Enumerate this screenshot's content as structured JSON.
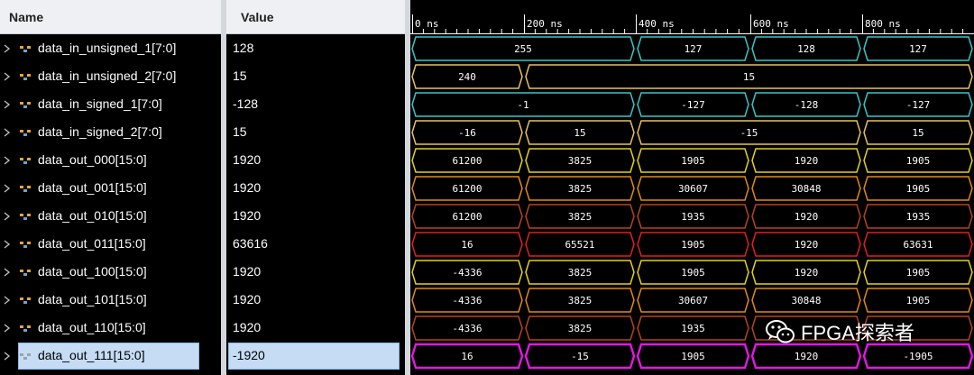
{
  "columns": {
    "name": "Name",
    "value": "Value"
  },
  "ruler": {
    "ticks": [
      "0 ns",
      "200 ns",
      "400 ns",
      "600 ns",
      "800 ns"
    ]
  },
  "selected_index": 11,
  "signals": [
    {
      "name": "data_in_unsigned_1[7:0]",
      "value": "128",
      "icon": "bus-icon",
      "color": "#36c7c9",
      "segments": [
        "255",
        "127",
        "128",
        "127"
      ],
      "boundaries": [
        0,
        250,
        377,
        501,
        625
      ]
    },
    {
      "name": "data_in_unsigned_2[7:0]",
      "value": "15",
      "icon": "bus-icon",
      "color": "#e6c25a",
      "segments": [
        "240",
        "15"
      ],
      "boundaries": [
        0,
        126,
        625
      ]
    },
    {
      "name": "data_in_signed_1[7:0]",
      "value": "-128",
      "icon": "bus-icon",
      "color": "#36c7c9",
      "segments": [
        "-1",
        "-127",
        "-128",
        "-127"
      ],
      "boundaries": [
        0,
        250,
        377,
        501,
        625
      ]
    },
    {
      "name": "data_in_signed_2[7:0]",
      "value": "15",
      "icon": "bus-icon",
      "color": "#e6c25a",
      "segments": [
        "-16",
        "15",
        "-15",
        "15"
      ],
      "boundaries": [
        0,
        126,
        250,
        501,
        625
      ]
    },
    {
      "name": "data_out_000[15:0]",
      "value": "1920",
      "icon": "bus-icon",
      "color": "#e3d21b",
      "segments": [
        "61200",
        "3825",
        "1905",
        "1920",
        "1905"
      ],
      "boundaries": [
        0,
        126,
        250,
        377,
        501,
        625
      ]
    },
    {
      "name": "data_out_001[15:0]",
      "value": "1920",
      "icon": "bus-icon",
      "color": "#e08a16",
      "segments": [
        "61200",
        "3825",
        "30607",
        "30848",
        "1905"
      ],
      "boundaries": [
        0,
        126,
        250,
        377,
        501,
        625
      ]
    },
    {
      "name": "data_out_010[15:0]",
      "value": "1920",
      "icon": "bus-icon",
      "color": "#b3451d",
      "segments": [
        "61200",
        "3825",
        "1935",
        "1920",
        "1935"
      ],
      "boundaries": [
        0,
        126,
        250,
        377,
        501,
        625
      ]
    },
    {
      "name": "data_out_011[15:0]",
      "value": "63616",
      "icon": "bus-icon",
      "color": "#e02020",
      "segments": [
        "16",
        "65521",
        "1905",
        "1920",
        "63631"
      ],
      "boundaries": [
        0,
        126,
        250,
        377,
        501,
        625
      ]
    },
    {
      "name": "data_out_100[15:0]",
      "value": "1920",
      "icon": "bus-icon",
      "color": "#e3d21b",
      "segments": [
        "-4336",
        "3825",
        "1905",
        "1920",
        "1905"
      ],
      "boundaries": [
        0,
        126,
        250,
        377,
        501,
        625
      ]
    },
    {
      "name": "data_out_101[15:0]",
      "value": "1920",
      "icon": "bus-icon",
      "color": "#e08a16",
      "segments": [
        "-4336",
        "3825",
        "30607",
        "30848",
        "1905"
      ],
      "boundaries": [
        0,
        126,
        250,
        377,
        501,
        625
      ]
    },
    {
      "name": "data_out_110[15:0]",
      "value": "1920",
      "icon": "bus-icon",
      "color": "#b3451d",
      "segments": [
        "-4336",
        "3825",
        "1935",
        "",
        ""
      ],
      "boundaries": [
        0,
        126,
        250,
        377,
        501,
        625
      ]
    },
    {
      "name": "data_out_111[15:0]",
      "value": "-1920",
      "icon": "bus-icon",
      "color": "#e516e5",
      "segments": [
        "16",
        "-15",
        "1905",
        "1920",
        "-1905"
      ],
      "boundaries": [
        0,
        126,
        250,
        377,
        501,
        625
      ]
    }
  ],
  "watermark": {
    "text": "FPGA探索者",
    "icon": "wechat-icon"
  }
}
